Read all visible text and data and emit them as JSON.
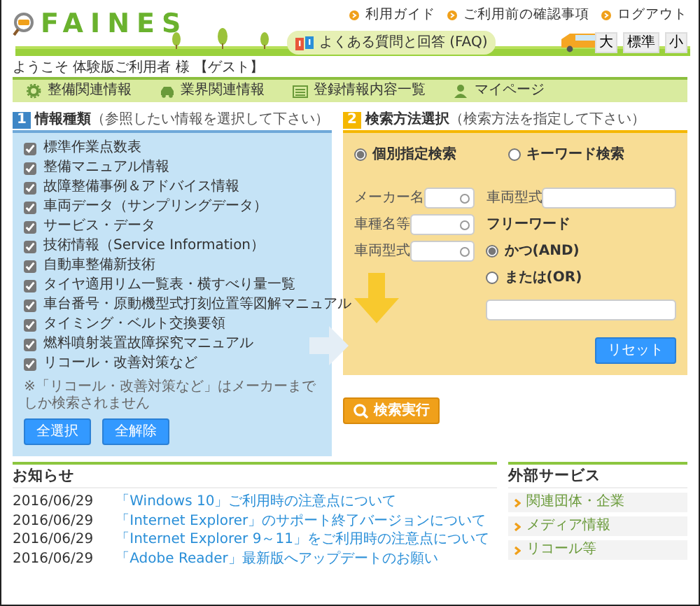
{
  "header": {
    "logo": "FAINES",
    "top_links": [
      "利用ガイド",
      "ご利用前の確認事項",
      "ログアウト"
    ],
    "faq": "よくある質問と回答 (FAQ)",
    "font_sizes": [
      "大",
      "標準",
      "小"
    ]
  },
  "welcome": "ようこそ 体験版ご利用者 様 【ゲスト】",
  "nav": [
    {
      "label": "整備関連情報"
    },
    {
      "label": "業界関連情報"
    },
    {
      "label": "登録情報内容一覧"
    },
    {
      "label": "マイページ"
    }
  ],
  "panel_1": {
    "number": "1",
    "title": "情報種類",
    "hint": "（参照したい情報を選択して下さい）",
    "items": [
      {
        "label": "標準作業点数表",
        "checked": true
      },
      {
        "label": "整備マニュアル情報",
        "checked": true
      },
      {
        "label": "故障整備事例＆アドバイス情報",
        "checked": true
      },
      {
        "label": "車両データ（サンプリングデータ）",
        "checked": true
      },
      {
        "label": "サービス・データ",
        "checked": true
      },
      {
        "label": "技術情報（Service Information）",
        "checked": true
      },
      {
        "label": "自動車整備新技術",
        "checked": true
      },
      {
        "label": "タイヤ適用リム一覧表・横すべり量一覧",
        "checked": true
      },
      {
        "label": "車台番号・原動機型式打刻位置等図解マニュアル",
        "checked": true
      },
      {
        "label": "タイミング・ベルト交換要領",
        "checked": true
      },
      {
        "label": "燃料噴射装置故障探究マニュアル",
        "checked": true
      },
      {
        "label": "リコール・改善対策など",
        "checked": true
      }
    ],
    "note": "※「リコール・改善対策など」はメーカーまでしか検索されません",
    "buttons": [
      "全選択",
      "全解除"
    ]
  },
  "panel_2": {
    "number": "2",
    "title": "検索方法選択",
    "hint": "（検索方法を指定して下さい）",
    "modes": [
      {
        "label": "個別指定検索",
        "selected": true
      },
      {
        "label": "キーワード検索",
        "selected": false
      }
    ],
    "fields": [
      {
        "label": "メーカー名"
      },
      {
        "label": "車種名等"
      },
      {
        "label": "車両型式"
      }
    ],
    "model_field": {
      "label": "車両型式"
    },
    "freeword_title": "フリーワード",
    "operators": [
      {
        "label": "かつ(AND)",
        "selected": true
      },
      {
        "label": "または(OR)",
        "selected": false
      }
    ],
    "reset": "リセット"
  },
  "search_button": "検索実行",
  "news": {
    "title": "お知らせ",
    "items": [
      {
        "date": "2016/06/29",
        "title": "「Windows 10」ご利用時の注意点について"
      },
      {
        "date": "2016/06/29",
        "title": "「Internet Explorer」のサポート終了バージョンについて"
      },
      {
        "date": "2016/06/29",
        "title": "「Internet Explorer 9～11」をご利用時の注意点について"
      },
      {
        "date": "2016/06/29",
        "title": "「Adobe Reader」最新版へアップデートのお願い"
      }
    ]
  },
  "external": {
    "title": "外部サービス",
    "links": [
      "関連団体・企業",
      "メディア情報",
      "リコール等"
    ]
  }
}
